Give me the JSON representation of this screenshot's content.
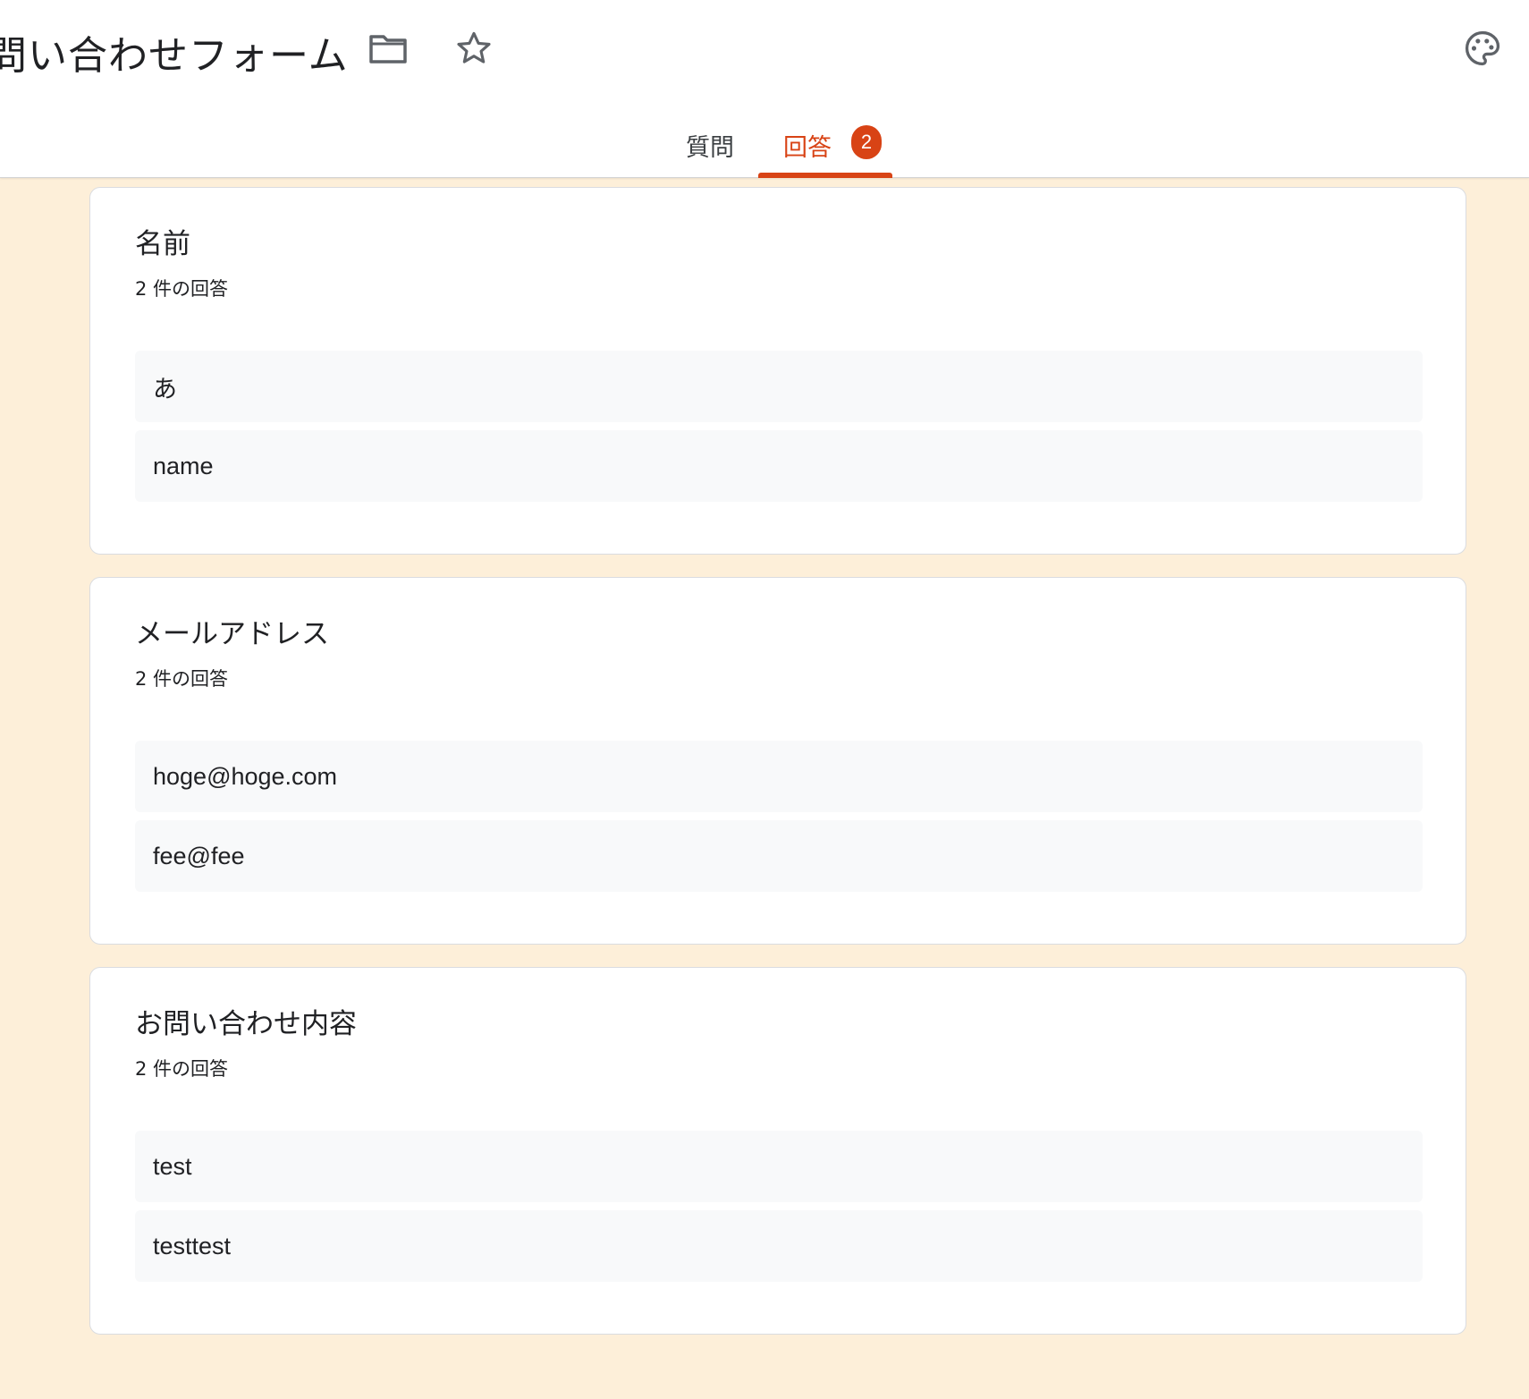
{
  "header": {
    "form_title": "問い合わせフォーム",
    "icons": {
      "folder": "folder-icon",
      "star": "star-outline-icon",
      "palette": "palette-icon"
    }
  },
  "tabs": {
    "questions_label": "質問",
    "responses_label": "回答",
    "responses_badge": "2",
    "active": "responses",
    "accent_color": "#d84315"
  },
  "questions": [
    {
      "title": "名前",
      "count_text": "2 件の回答",
      "answers": [
        "あ",
        "name"
      ]
    },
    {
      "title": "メールアドレス",
      "count_text": "2 件の回答",
      "answers": [
        "hoge@hoge.com",
        "fee@fee"
      ]
    },
    {
      "title": "お問い合わせ内容",
      "count_text": "2 件の回答",
      "answers": [
        "test",
        "testtest"
      ]
    }
  ],
  "colors": {
    "page_background": "#fdefd9",
    "card_background": "#ffffff",
    "answer_background": "#f8f9fa"
  }
}
